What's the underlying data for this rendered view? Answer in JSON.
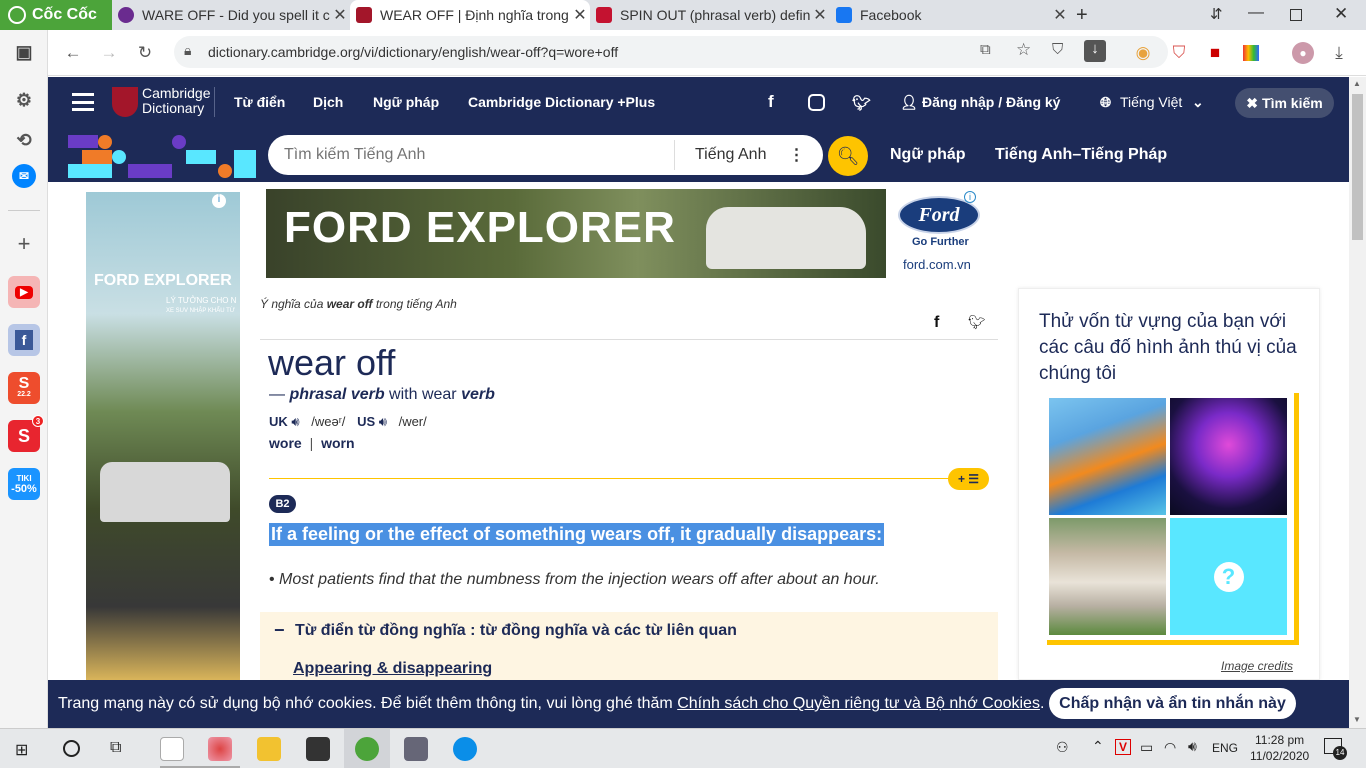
{
  "browser": {
    "brand": "Cốc Cốc",
    "tabs": [
      {
        "title": "WARE OFF - Did you spell it c",
        "favicon_color": "#6a2b8f"
      },
      {
        "title": "WEAR OFF | Định nghĩa trong",
        "favicon_color": "#a3162a"
      },
      {
        "title": "SPIN OUT (phrasal verb) defin",
        "favicon_color": "#c41230"
      },
      {
        "title": "Facebook",
        "favicon_color": "#1877f2"
      }
    ],
    "new_tab": "+",
    "url": "dictionary.cambridge.org/vi/dictionary/english/wear-off?q=wore+off"
  },
  "sidebar": {
    "items": [
      {
        "name": "settings-icon",
        "glyph": "⚙"
      },
      {
        "name": "history-icon",
        "glyph": "⟲"
      },
      {
        "name": "messenger-icon",
        "glyph": "✉"
      },
      {
        "name": "add-icon",
        "glyph": "+"
      },
      {
        "name": "youtube-icon",
        "glyph": "▶"
      },
      {
        "name": "facebook-icon",
        "glyph": "f"
      },
      {
        "name": "shopee-icon",
        "glyph": "S",
        "sub": "22.2"
      },
      {
        "name": "sendo-icon",
        "glyph": "S",
        "badge": "3"
      },
      {
        "name": "tiki-icon",
        "glyph": "TIKI",
        "sub": "-50%"
      }
    ]
  },
  "header": {
    "logo_line1": "Cambridge",
    "logo_line2": "Dictionary",
    "nav": [
      "Từ điển",
      "Dịch",
      "Ngữ pháp",
      "Cambridge Dictionary +Plus"
    ],
    "login": "Đăng nhập / Đăng ký",
    "language": "Tiếng Việt",
    "search_button": "Tìm kiếm"
  },
  "search": {
    "placeholder": "Tìm kiếm Tiếng Anh",
    "dictionary": "Tiếng Anh",
    "links": [
      "Ngữ pháp",
      "Tiếng Anh–Tiếng Pháp"
    ]
  },
  "ad": {
    "headline": "FORD EXPLORER",
    "brand": "Ford",
    "tagline": "Go Further",
    "site": "ford.com.vn",
    "side_headline": "FORD EXPLORER",
    "side_sub1": "LÝ TƯỞNG CHO N",
    "side_sub2": "XE SUV NHẬP KHẨU TỪ"
  },
  "entry": {
    "breadcrumb_pre": "Ý nghĩa của ",
    "breadcrumb_word": "wear off",
    "breadcrumb_post": " trong tiếng Anh",
    "headword": "wear off",
    "pos_dash": "— ",
    "pos": "phrasal verb",
    "pos_with": " with wear ",
    "pos_verb": "verb",
    "uk": "UK",
    "uk_ipa": "/weəʳ/",
    "us": "US",
    "us_ipa": "/wer/",
    "forms": [
      "wore",
      "worn"
    ],
    "level": "B2",
    "definition": "If a feeling or the effect of something wears off, it gradually disappears:",
    "example": "Most patients find that the numbness from the injection wears off after about an hour.",
    "thesaurus_title": "Từ điển từ đồng nghĩa : từ đồng nghĩa và các từ liên quan",
    "thesaurus_link": "Appearing & disappearing",
    "add_list": "+ ☰"
  },
  "quiz": {
    "title": "Thử vốn từ vựng của bạn với các câu đố hình ảnh thú vị của chúng tôi",
    "credits": "Image credits",
    "images": [
      "water-slide",
      "ferris-wheel",
      "playhouse",
      "question"
    ],
    "question_glyph": "?"
  },
  "cookie": {
    "text": "Trang mạng này có sử dụng bộ nhớ cookies. Để biết thêm thông tin, vui lòng ghé thăm ",
    "link": "Chính sách cho Quyền riêng tư và Bộ nhớ Cookies",
    "end": ".",
    "button": "Chấp nhận và ẩn tin nhắn này"
  },
  "taskbar": {
    "language": "ENG",
    "time": "11:28 pm",
    "date": "11/02/2020",
    "notifications": "14"
  },
  "colors": {
    "brand_navy": "#1d2a57",
    "accent_yellow": "#fec400",
    "highlight_blue": "#4a90e2",
    "coccoc_green": "#4ca43a"
  }
}
